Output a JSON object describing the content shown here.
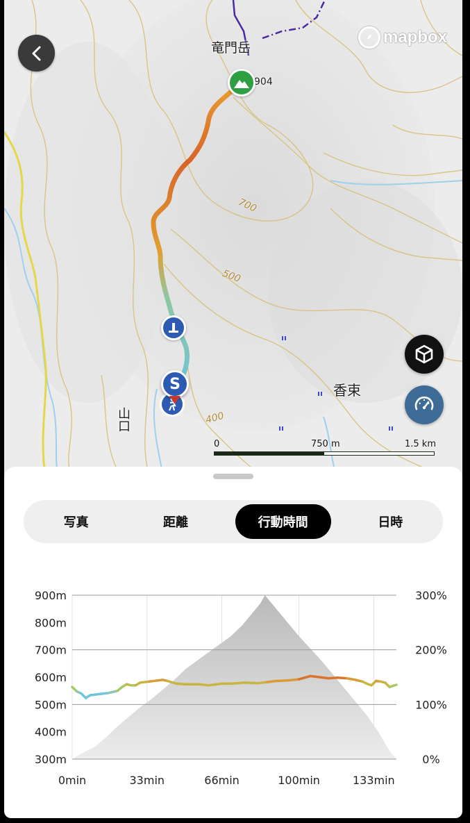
{
  "map": {
    "attribution": "mapbox",
    "place_labels": {
      "peak_name": "竜門岳",
      "peak_elev": "904",
      "town_right": "香束",
      "town_left": "山口"
    },
    "contour_labels": [
      "700",
      "500",
      "400"
    ],
    "scale": {
      "labels": [
        "0",
        "750 m",
        "1.5 km"
      ],
      "filled_fraction": 0.5
    },
    "markers": {
      "start_badge": "S",
      "summit": "mountain-icon",
      "facility": "toilet-icon",
      "trailhead": "hiker-icon"
    },
    "colors": {
      "route_low": "#6fc5d9",
      "route_mid": "#e0a030",
      "route_high": "#d8642a",
      "summit": "#2ea043",
      "start": "#2d5bb4"
    }
  },
  "controls": {
    "back": "chevron-left-icon",
    "view_3d": "cube-icon",
    "speed": "speedometer-icon"
  },
  "tabs": [
    {
      "label": "写真",
      "active": false
    },
    {
      "label": "距離",
      "active": false
    },
    {
      "label": "行動時間",
      "active": true
    },
    {
      "label": "日時",
      "active": false
    }
  ],
  "chart_data": {
    "type": "area",
    "x_ticks": [
      "0min",
      "33min",
      "66min",
      "100min",
      "133min"
    ],
    "y_left_ticks": [
      "900m",
      "800m",
      "700m",
      "600m",
      "500m",
      "400m",
      "300m"
    ],
    "y_right_ticks": [
      "300%",
      "200%",
      "100%",
      "0%"
    ],
    "x_range": [
      0,
      143
    ],
    "y_left_range": [
      300,
      900
    ],
    "y_right_range": [
      0,
      300
    ],
    "series": [
      {
        "kind": "elevation-area",
        "points": [
          [
            0,
            300
          ],
          [
            5,
            325
          ],
          [
            10,
            345
          ],
          [
            15,
            380
          ],
          [
            20,
            420
          ],
          [
            25,
            455
          ],
          [
            30,
            490
          ],
          [
            35,
            520
          ],
          [
            40,
            555
          ],
          [
            45,
            590
          ],
          [
            50,
            630
          ],
          [
            55,
            660
          ],
          [
            60,
            690
          ],
          [
            65,
            720
          ],
          [
            70,
            750
          ],
          [
            75,
            790
          ],
          [
            80,
            840
          ],
          [
            83,
            870
          ],
          [
            85,
            900
          ],
          [
            88,
            870
          ],
          [
            92,
            830
          ],
          [
            96,
            790
          ],
          [
            100,
            750
          ],
          [
            105,
            705
          ],
          [
            110,
            660
          ],
          [
            115,
            610
          ],
          [
            120,
            560
          ],
          [
            125,
            510
          ],
          [
            130,
            460
          ],
          [
            135,
            400
          ],
          [
            140,
            330
          ],
          [
            143,
            300
          ]
        ]
      },
      {
        "kind": "pace-line",
        "points": [
          [
            0,
            132
          ],
          [
            2,
            124
          ],
          [
            4,
            120
          ],
          [
            6,
            112
          ],
          [
            8,
            117
          ],
          [
            12,
            119
          ],
          [
            16,
            121
          ],
          [
            20,
            125
          ],
          [
            22,
            132
          ],
          [
            24,
            137
          ],
          [
            26,
            135
          ],
          [
            28,
            135
          ],
          [
            30,
            140
          ],
          [
            34,
            142
          ],
          [
            38,
            144
          ],
          [
            40,
            145
          ],
          [
            42,
            143
          ],
          [
            46,
            138
          ],
          [
            50,
            137
          ],
          [
            56,
            137
          ],
          [
            60,
            135
          ],
          [
            66,
            138
          ],
          [
            70,
            138
          ],
          [
            76,
            140
          ],
          [
            82,
            139
          ],
          [
            86,
            141
          ],
          [
            90,
            143
          ],
          [
            95,
            144
          ],
          [
            100,
            146
          ],
          [
            105,
            152
          ],
          [
            109,
            150
          ],
          [
            113,
            148
          ],
          [
            117,
            149
          ],
          [
            121,
            148
          ],
          [
            125,
            145
          ],
          [
            128,
            142
          ],
          [
            130,
            138
          ],
          [
            132,
            135
          ],
          [
            134,
            143
          ],
          [
            136,
            142
          ],
          [
            138,
            140
          ],
          [
            140,
            132
          ],
          [
            143,
            136
          ]
        ]
      }
    ]
  }
}
